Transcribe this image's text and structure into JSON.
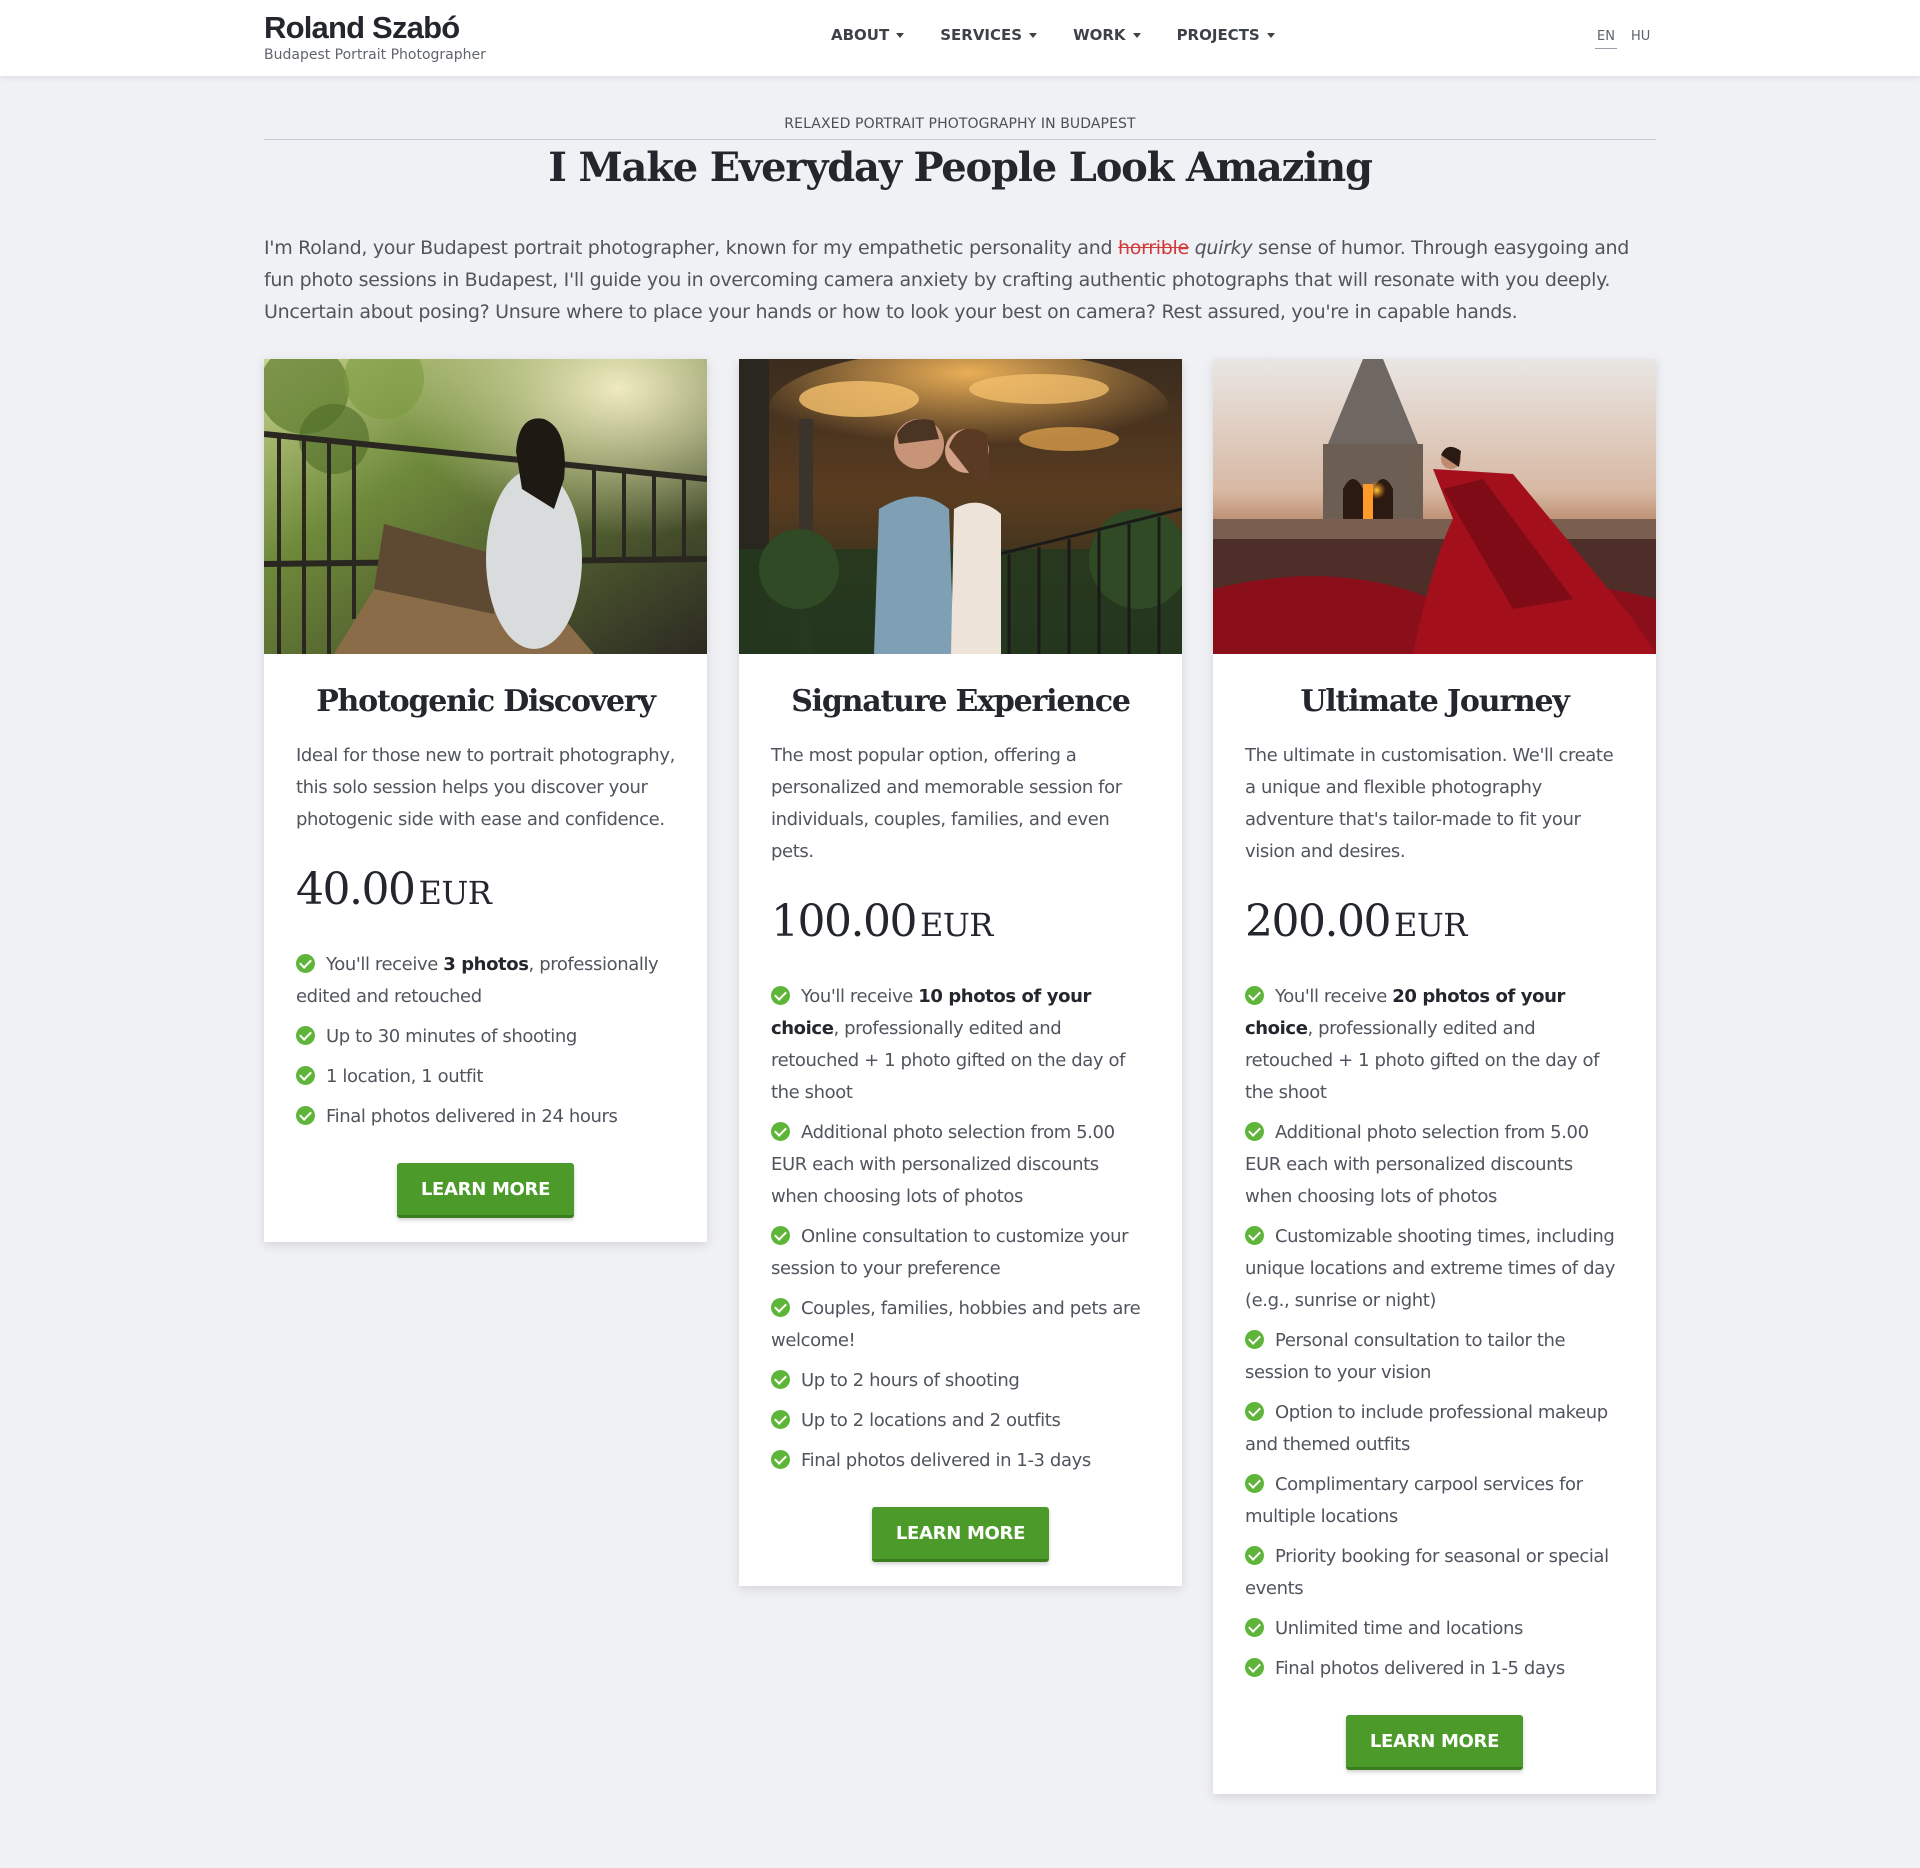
{
  "header": {
    "brand_name": "Roland Szabó",
    "brand_subtitle": "Budapest Portrait Photographer",
    "nav": [
      "ABOUT",
      "SERVICES",
      "WORK",
      "PROJECTS"
    ],
    "languages": [
      "EN",
      "HU"
    ],
    "active_language": "EN"
  },
  "intro": {
    "eyebrow": "RELAXED PORTRAIT PHOTOGRAPHY IN BUDAPEST",
    "headline": "I Make Everyday People Look Amazing",
    "text_before": "I'm Roland, your Budapest portrait photographer, known for my empathetic personality and ",
    "struck_word": "horrible",
    "italic_word": "quirky",
    "text_after": " sense of humor. Through easygoing and fun photo sessions in Budapest, I'll guide you in overcoming camera anxiety by crafting authentic photographs that will resonate with you deeply. Uncertain about posing? Unsure where to place your hands or how to look your best on camera? Rest assured, you're in capable hands."
  },
  "cards": [
    {
      "title": "Photogenic Discovery",
      "description": "Ideal for those new to portrait photography, this solo session helps you discover your photogenic side with ease and confidence.",
      "price": "40.00",
      "currency": "EUR",
      "features": [
        {
          "pre": "You'll receive ",
          "bold": "3 photos",
          "post": ", professionally edited and retouched"
        },
        {
          "pre": "Up to 30 minutes of shooting",
          "bold": "",
          "post": ""
        },
        {
          "pre": "1 location, 1 outfit",
          "bold": "",
          "post": ""
        },
        {
          "pre": "Final photos delivered in 24 hours",
          "bold": "",
          "post": ""
        }
      ],
      "button": "LEARN MORE"
    },
    {
      "title": "Signature Experience",
      "description": "The most popular option, offering a personalized and memorable session for individuals, couples, families, and even pets.",
      "price": "100.00",
      "currency": "EUR",
      "features": [
        {
          "pre": "You'll receive ",
          "bold": "10 photos of your choice",
          "post": ", professionally edited and retouched + 1 photo gifted on the day of the shoot"
        },
        {
          "pre": "Additional photo selection from 5.00 EUR each with personalized discounts when choosing lots of photos",
          "bold": "",
          "post": ""
        },
        {
          "pre": "Online consultation to customize your session to your preference",
          "bold": "",
          "post": ""
        },
        {
          "pre": "Couples, families, hobbies and pets are welcome!",
          "bold": "",
          "post": ""
        },
        {
          "pre": "Up to 2 hours of shooting",
          "bold": "",
          "post": ""
        },
        {
          "pre": "Up to 2 locations and 2 outfits",
          "bold": "",
          "post": ""
        },
        {
          "pre": "Final photos delivered in 1-3 days",
          "bold": "",
          "post": ""
        }
      ],
      "button": "LEARN MORE"
    },
    {
      "title": "Ultimate Journey",
      "description": "The ultimate in customisation. We'll create a unique and flexible photography adventure that's tailor-made to fit your vision and desires.",
      "price": "200.00",
      "currency": "EUR",
      "features": [
        {
          "pre": "You'll receive ",
          "bold": "20 photos of your choice",
          "post": ", professionally edited and retouched + 1 photo gifted on the day of the shoot"
        },
        {
          "pre": "Additional photo selection from 5.00 EUR each with personalized discounts when choosing lots of photos",
          "bold": "",
          "post": ""
        },
        {
          "pre": "Customizable shooting times, including unique locations and extreme times of day (e.g., sunrise or night)",
          "bold": "",
          "post": ""
        },
        {
          "pre": "Personal consultation to tailor the session to your vision",
          "bold": "",
          "post": ""
        },
        {
          "pre": "Option to include professional makeup and themed outfits",
          "bold": "",
          "post": ""
        },
        {
          "pre": "Complimentary carpool services for multiple locations",
          "bold": "",
          "post": ""
        },
        {
          "pre": "Priority booking for seasonal or special events",
          "bold": "",
          "post": ""
        },
        {
          "pre": "Unlimited time and locations",
          "bold": "",
          "post": ""
        },
        {
          "pre": "Final photos delivered in 1-5 days",
          "bold": "",
          "post": ""
        }
      ],
      "button": "LEARN MORE"
    }
  ],
  "colors": {
    "accent_green": "#4c9a2a",
    "check_green": "#5fb53a",
    "strike_red": "#d13a3a",
    "page_bg": "#f0f1f5"
  },
  "icons": [
    "check-circle-icon",
    "chevron-down-icon"
  ]
}
